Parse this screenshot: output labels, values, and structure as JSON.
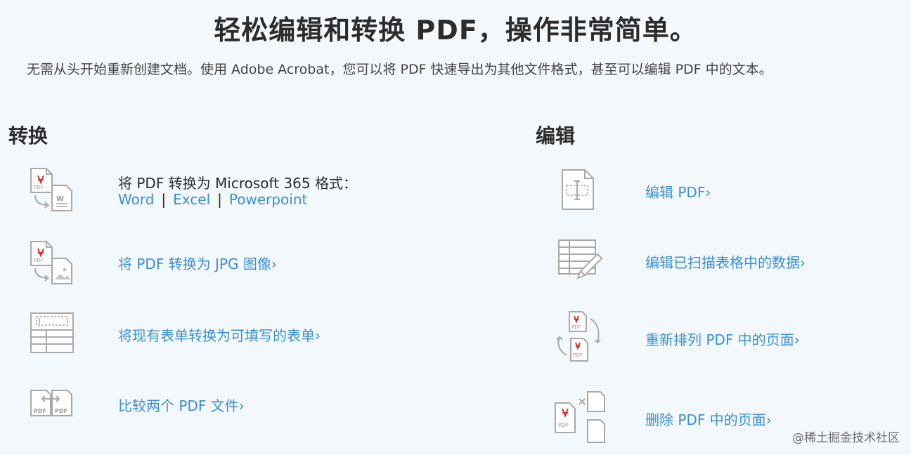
{
  "header": {
    "title": "轻松编辑和转换 PDF，操作非常简单。",
    "subtitle": "无需从头开始重新创建文档。使用 Adobe Acrobat，您可以将 PDF 快速导出为其他文件格式，甚至可以编辑 PDF 中的文本。"
  },
  "convert": {
    "heading": "转换",
    "office_text": "将 PDF 转换为 Microsoft 365 格式：",
    "office_links": [
      "Word",
      "Excel",
      "Powerpoint"
    ],
    "separator": "|",
    "items": [
      {
        "label": "将 PDF 转换为 JPG 图像",
        "icon": "pdf-to-image-icon"
      },
      {
        "label": "将现有表单转换为可填写的表单",
        "icon": "form-icon"
      },
      {
        "label": "比较两个 PDF 文件",
        "icon": "compare-pdf-icon"
      }
    ]
  },
  "edit": {
    "heading": "编辑",
    "items": [
      {
        "label": "编辑 PDF",
        "icon": "edit-text-icon"
      },
      {
        "label": "编辑已扫描表格中的数据",
        "icon": "edit-table-icon"
      },
      {
        "label": "重新排列 PDF 中的页面",
        "icon": "reorder-pages-icon"
      },
      {
        "label": "删除 PDF 中的页面",
        "icon": "delete-pages-icon"
      }
    ]
  },
  "chevron": "›",
  "watermark": "@稀土掘金技术社区",
  "colors": {
    "link": "#3a8fd4",
    "icon": "#a9a9a9",
    "pdf_red": "#d9322c",
    "background": "#f3f8fc"
  }
}
